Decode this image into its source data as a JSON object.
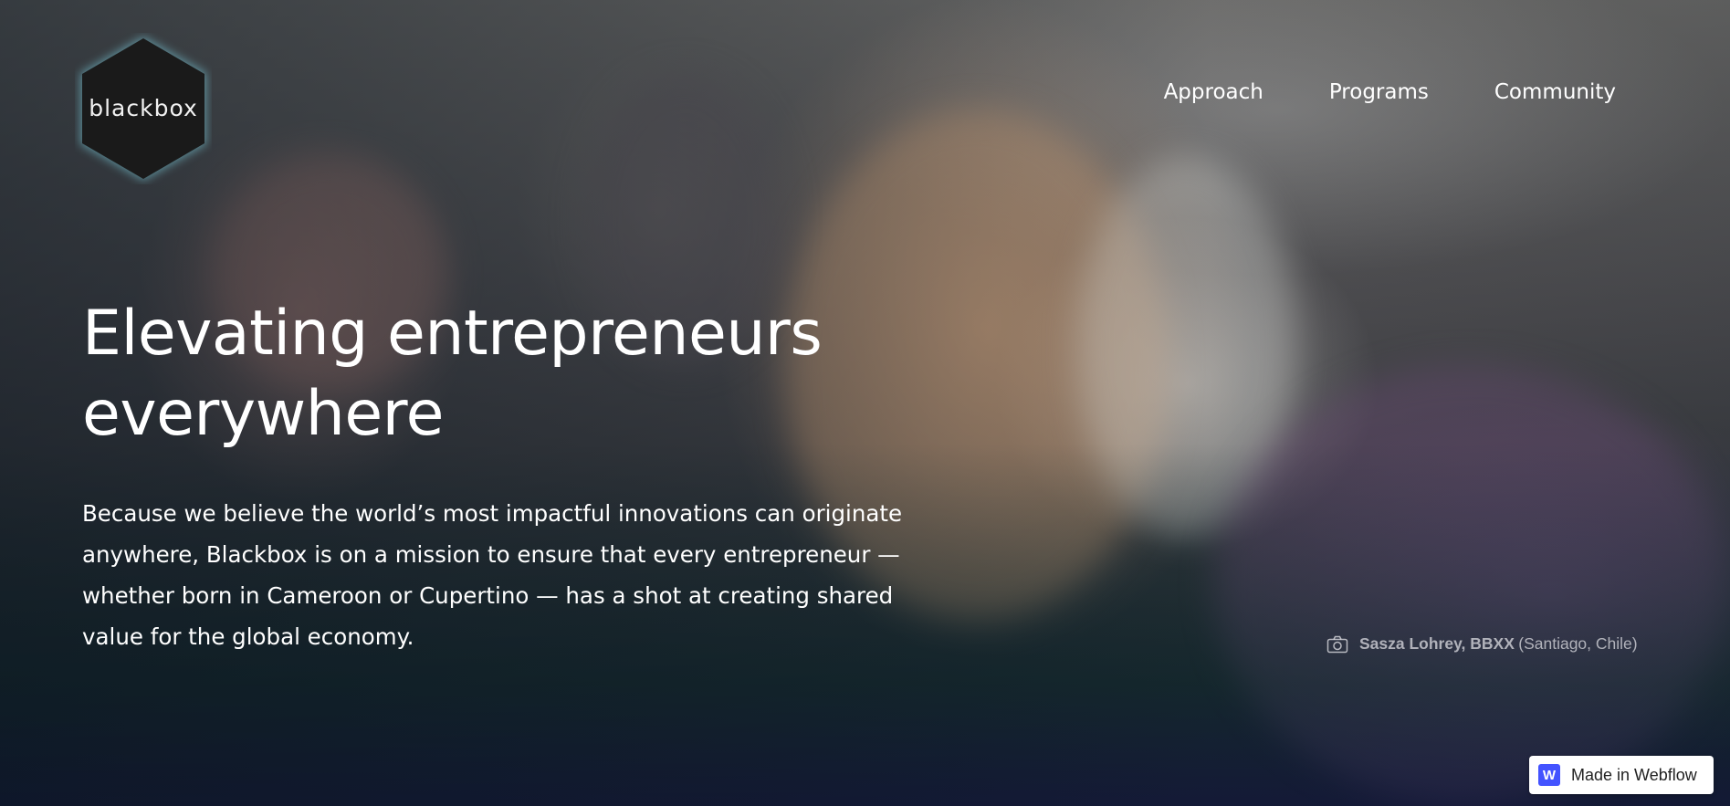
{
  "brand": {
    "logo_text": "blackbox",
    "logo_icon": "hexagon-logo-icon"
  },
  "nav": {
    "items": [
      {
        "label": "Approach"
      },
      {
        "label": "Programs"
      },
      {
        "label": "Community"
      }
    ]
  },
  "hero": {
    "headline_line1": "Elevating entrepreneurs",
    "headline_line2": "everywhere",
    "lede": "Because we believe the world’s most impactful innovations can originate anywhere, Blackbox is on a mission to ensure that every entrepreneur — whether born in Cameroon or Cupertino — has a shot at creating shared value for the global economy."
  },
  "photo_credit": {
    "icon": "camera-icon",
    "name": "Sasza Lohrey, BBXX",
    "location": "(Santiago, Chile)"
  },
  "webflow_badge": {
    "icon_letter": "W",
    "label": "Made in Webflow",
    "accent": "#4353ff"
  },
  "colors": {
    "text": "#ffffff",
    "logo_bg": "#1a1a1a",
    "logo_glow": "#7fd6e6"
  }
}
